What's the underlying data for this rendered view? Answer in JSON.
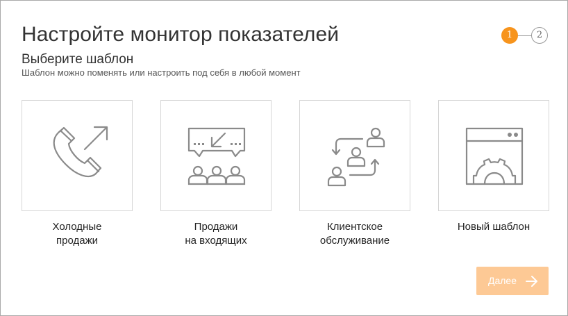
{
  "header": {
    "title": "Настройте монитор показателей",
    "subtitle": "Выберите шаблон",
    "hint": "Шаблон можно поменять или настроить под себя в любой момент"
  },
  "steps": {
    "current": "1",
    "next": "2",
    "accent_color": "#f7941d"
  },
  "templates": [
    {
      "label": "Холодные\nпродажи",
      "icon": "phone-outgoing-icon"
    },
    {
      "label": "Продажи\nна входящих",
      "icon": "incoming-chat-audience-icon"
    },
    {
      "label": "Клиентское\nобслуживание",
      "icon": "customer-exchange-icon"
    },
    {
      "label": "Новый шаблон",
      "icon": "window-gear-icon"
    }
  ],
  "footer": {
    "next_label": "Далее",
    "next_color": "#fdc995"
  }
}
